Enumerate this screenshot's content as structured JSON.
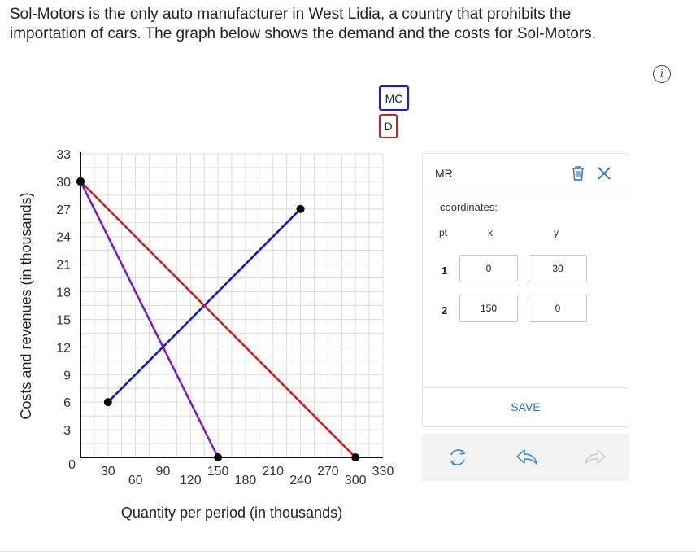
{
  "question": {
    "line1": "Sol-Motors is the only auto manufacturer in West Lidia, a country that prohibits the",
    "line2": "importation of cars. The graph below shows the demand and the costs for Sol-Motors."
  },
  "info_icon_glyph": "i",
  "legend": {
    "mc_label": "MC",
    "d_label": "D"
  },
  "panel": {
    "title": "MR",
    "coords_label": "coordinates:",
    "headers": {
      "pt": "pt",
      "x": "x",
      "y": "y"
    },
    "points": [
      {
        "pt": "1",
        "x": "0",
        "y": "30"
      },
      {
        "pt": "2",
        "x": "150",
        "y": "0"
      }
    ],
    "save_label": "SAVE"
  },
  "colors": {
    "mc": "#1414c8",
    "demand": "#d41a1a",
    "mr": "#7a14c8",
    "accent": "#2a6fbd"
  },
  "chart_data": {
    "type": "line",
    "xlabel": "Quantity per period (in thousands)",
    "ylabel": "Costs and revenues (in thousands)",
    "xlim": [
      0,
      330
    ],
    "ylim": [
      0,
      33
    ],
    "x_ticks": [
      30,
      60,
      90,
      120,
      150,
      180,
      210,
      240,
      270,
      300,
      330
    ],
    "y_ticks": [
      0,
      3,
      6,
      9,
      12,
      15,
      18,
      21,
      24,
      27,
      30,
      33
    ],
    "grid": true,
    "series": [
      {
        "name": "MC",
        "color": "#1414c8",
        "points": [
          [
            30,
            6
          ],
          [
            240,
            27
          ]
        ]
      },
      {
        "name": "D",
        "color": "#d41a1a",
        "points": [
          [
            0,
            30
          ],
          [
            300,
            0
          ]
        ]
      },
      {
        "name": "MR",
        "color": "#7a14c8",
        "points": [
          [
            0,
            30
          ],
          [
            150,
            0
          ]
        ]
      }
    ]
  }
}
